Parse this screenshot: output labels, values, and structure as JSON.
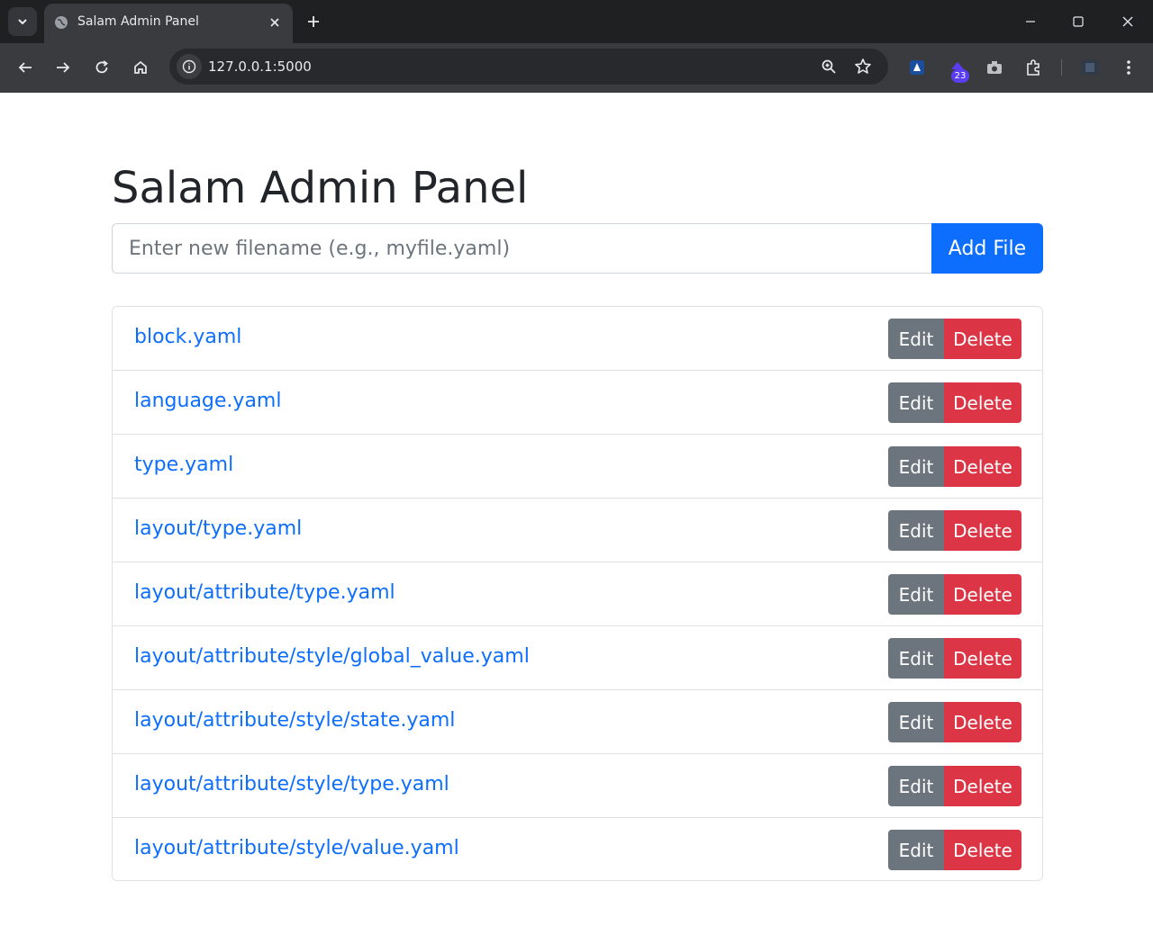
{
  "browser": {
    "tab_title": "Salam Admin Panel",
    "url": "127.0.0.1:5000",
    "extension_badge": "23"
  },
  "page": {
    "title": "Salam Admin Panel",
    "input_placeholder": "Enter new filename (e.g., myfile.yaml)",
    "add_button": "Add File",
    "edit_label": "Edit",
    "delete_label": "Delete",
    "files": [
      "block.yaml",
      "language.yaml",
      "type.yaml",
      "layout/type.yaml",
      "layout/attribute/type.yaml",
      "layout/attribute/style/global_value.yaml",
      "layout/attribute/style/state.yaml",
      "layout/attribute/style/type.yaml",
      "layout/attribute/style/value.yaml"
    ]
  },
  "colors": {
    "primary": "#0d6efd",
    "secondary": "#6c757d",
    "danger": "#dc3545"
  }
}
